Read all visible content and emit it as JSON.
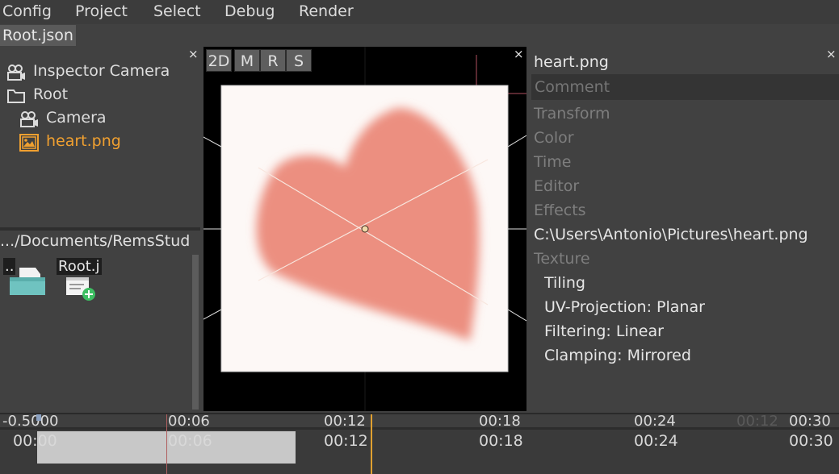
{
  "menu": {
    "items": [
      {
        "label": "Config"
      },
      {
        "label": "Project"
      },
      {
        "label": "Select"
      },
      {
        "label": "Debug"
      },
      {
        "label": "Render"
      }
    ]
  },
  "file_tab": {
    "label": "Root.json"
  },
  "scene_tree": {
    "close_label": "×",
    "items": [
      {
        "label": "Inspector Camera",
        "icon": "camera-icon",
        "selected": false
      },
      {
        "label": "Root",
        "icon": "folder-icon",
        "selected": false
      },
      {
        "label": "Camera",
        "icon": "camera-icon",
        "selected": false
      },
      {
        "label": "heart.png",
        "icon": "image-icon",
        "selected": true
      }
    ]
  },
  "file_browser": {
    "path": ".../Documents/RemsStud",
    "items": [
      {
        "label": "..",
        "icon": "folder-up-icon"
      },
      {
        "label": "Root.j",
        "icon": "new-file-icon"
      }
    ]
  },
  "viewport": {
    "close_label": "×",
    "buttons": [
      {
        "label": "2D"
      },
      {
        "label": "M"
      },
      {
        "label": "R"
      },
      {
        "label": "S"
      }
    ]
  },
  "properties": {
    "close_label": "×",
    "title": "heart.png",
    "comment_placeholder": "Comment",
    "sections": [
      "Transform",
      "Color",
      "Time",
      "Editor",
      "Effects"
    ],
    "path": "C:\\Users\\Antonio\\Pictures\\heart.png",
    "texture_label": "Texture",
    "texture_props": [
      {
        "label": "Tiling"
      },
      {
        "label": "UV-Projection: Planar"
      },
      {
        "label": "Filtering: Linear"
      },
      {
        "label": "Clamping: Mirrored"
      }
    ]
  },
  "timeline": {
    "top_labels": [
      "-0.5000",
      "00:06",
      "00:12",
      "00:18",
      "00:24",
      "00:30"
    ],
    "overlay_time": "00:12",
    "labels": [
      "00:00",
      "00:06",
      "00:12",
      "00:18",
      "00:24",
      "00:30"
    ]
  },
  "colors": {
    "selected_item": "#f0a030",
    "heart": "#ec8f80",
    "playhead": "#e0a030"
  }
}
